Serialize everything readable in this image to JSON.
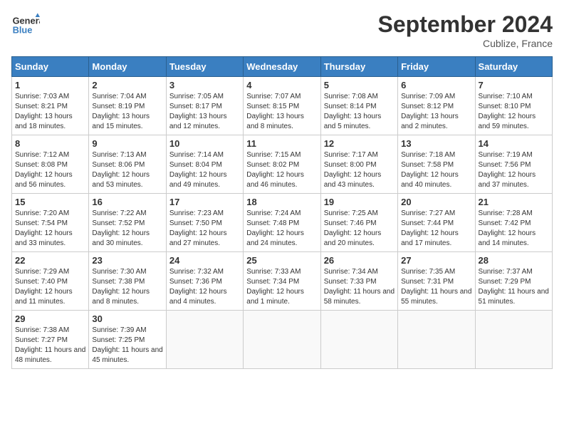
{
  "header": {
    "logo_line1": "General",
    "logo_line2": "Blue",
    "month_title": "September 2024",
    "location": "Cublize, France"
  },
  "days_of_week": [
    "Sunday",
    "Monday",
    "Tuesday",
    "Wednesday",
    "Thursday",
    "Friday",
    "Saturday"
  ],
  "weeks": [
    [
      {
        "day": 1,
        "sunrise": "7:03 AM",
        "sunset": "8:21 PM",
        "daylight": "13 hours and 18 minutes."
      },
      {
        "day": 2,
        "sunrise": "7:04 AM",
        "sunset": "8:19 PM",
        "daylight": "13 hours and 15 minutes."
      },
      {
        "day": 3,
        "sunrise": "7:05 AM",
        "sunset": "8:17 PM",
        "daylight": "13 hours and 12 minutes."
      },
      {
        "day": 4,
        "sunrise": "7:07 AM",
        "sunset": "8:15 PM",
        "daylight": "13 hours and 8 minutes."
      },
      {
        "day": 5,
        "sunrise": "7:08 AM",
        "sunset": "8:14 PM",
        "daylight": "13 hours and 5 minutes."
      },
      {
        "day": 6,
        "sunrise": "7:09 AM",
        "sunset": "8:12 PM",
        "daylight": "13 hours and 2 minutes."
      },
      {
        "day": 7,
        "sunrise": "7:10 AM",
        "sunset": "8:10 PM",
        "daylight": "12 hours and 59 minutes."
      }
    ],
    [
      {
        "day": 8,
        "sunrise": "7:12 AM",
        "sunset": "8:08 PM",
        "daylight": "12 hours and 56 minutes."
      },
      {
        "day": 9,
        "sunrise": "7:13 AM",
        "sunset": "8:06 PM",
        "daylight": "12 hours and 53 minutes."
      },
      {
        "day": 10,
        "sunrise": "7:14 AM",
        "sunset": "8:04 PM",
        "daylight": "12 hours and 49 minutes."
      },
      {
        "day": 11,
        "sunrise": "7:15 AM",
        "sunset": "8:02 PM",
        "daylight": "12 hours and 46 minutes."
      },
      {
        "day": 12,
        "sunrise": "7:17 AM",
        "sunset": "8:00 PM",
        "daylight": "12 hours and 43 minutes."
      },
      {
        "day": 13,
        "sunrise": "7:18 AM",
        "sunset": "7:58 PM",
        "daylight": "12 hours and 40 minutes."
      },
      {
        "day": 14,
        "sunrise": "7:19 AM",
        "sunset": "7:56 PM",
        "daylight": "12 hours and 37 minutes."
      }
    ],
    [
      {
        "day": 15,
        "sunrise": "7:20 AM",
        "sunset": "7:54 PM",
        "daylight": "12 hours and 33 minutes."
      },
      {
        "day": 16,
        "sunrise": "7:22 AM",
        "sunset": "7:52 PM",
        "daylight": "12 hours and 30 minutes."
      },
      {
        "day": 17,
        "sunrise": "7:23 AM",
        "sunset": "7:50 PM",
        "daylight": "12 hours and 27 minutes."
      },
      {
        "day": 18,
        "sunrise": "7:24 AM",
        "sunset": "7:48 PM",
        "daylight": "12 hours and 24 minutes."
      },
      {
        "day": 19,
        "sunrise": "7:25 AM",
        "sunset": "7:46 PM",
        "daylight": "12 hours and 20 minutes."
      },
      {
        "day": 20,
        "sunrise": "7:27 AM",
        "sunset": "7:44 PM",
        "daylight": "12 hours and 17 minutes."
      },
      {
        "day": 21,
        "sunrise": "7:28 AM",
        "sunset": "7:42 PM",
        "daylight": "12 hours and 14 minutes."
      }
    ],
    [
      {
        "day": 22,
        "sunrise": "7:29 AM",
        "sunset": "7:40 PM",
        "daylight": "12 hours and 11 minutes."
      },
      {
        "day": 23,
        "sunrise": "7:30 AM",
        "sunset": "7:38 PM",
        "daylight": "12 hours and 8 minutes."
      },
      {
        "day": 24,
        "sunrise": "7:32 AM",
        "sunset": "7:36 PM",
        "daylight": "12 hours and 4 minutes."
      },
      {
        "day": 25,
        "sunrise": "7:33 AM",
        "sunset": "7:34 PM",
        "daylight": "12 hours and 1 minute."
      },
      {
        "day": 26,
        "sunrise": "7:34 AM",
        "sunset": "7:33 PM",
        "daylight": "11 hours and 58 minutes."
      },
      {
        "day": 27,
        "sunrise": "7:35 AM",
        "sunset": "7:31 PM",
        "daylight": "11 hours and 55 minutes."
      },
      {
        "day": 28,
        "sunrise": "7:37 AM",
        "sunset": "7:29 PM",
        "daylight": "11 hours and 51 minutes."
      }
    ],
    [
      {
        "day": 29,
        "sunrise": "7:38 AM",
        "sunset": "7:27 PM",
        "daylight": "11 hours and 48 minutes."
      },
      {
        "day": 30,
        "sunrise": "7:39 AM",
        "sunset": "7:25 PM",
        "daylight": "11 hours and 45 minutes."
      },
      null,
      null,
      null,
      null,
      null
    ]
  ]
}
